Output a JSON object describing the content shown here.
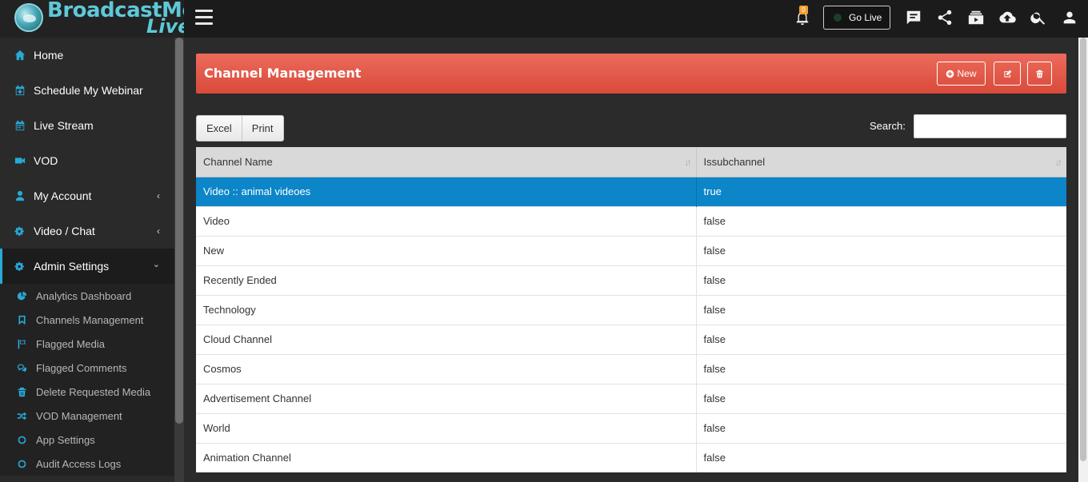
{
  "app": {
    "logo_text": "BroadcastMe",
    "logo_text2": "Live"
  },
  "topbar": {
    "notification_count": "0",
    "go_live_label": "Go Live"
  },
  "sidebar": {
    "items": [
      {
        "label": "Home",
        "icon": "home-icon"
      },
      {
        "label": "Schedule My Webinar",
        "icon": "calendar-plus-icon"
      },
      {
        "label": "Live Stream",
        "icon": "calendar-icon"
      },
      {
        "label": "VOD",
        "icon": "video-camera-icon"
      },
      {
        "label": "My Account",
        "icon": "user-icon"
      },
      {
        "label": "Video / Chat",
        "icon": "gears-icon"
      },
      {
        "label": "Admin Settings",
        "icon": "gears-icon"
      }
    ],
    "sub_items": [
      {
        "label": "Analytics Dashboard",
        "icon": "pie-chart-icon"
      },
      {
        "label": "Channels Management",
        "icon": "bookmark-icon"
      },
      {
        "label": "Flagged Media",
        "icon": "flag-icon"
      },
      {
        "label": "Flagged Comments",
        "icon": "comments-icon"
      },
      {
        "label": "Delete Requested Media",
        "icon": "trash-icon"
      },
      {
        "label": "VOD Management",
        "icon": "shuffle-icon"
      },
      {
        "label": "App Settings",
        "icon": "circle-icon"
      },
      {
        "label": "Audit Access Logs",
        "icon": "circle-icon"
      }
    ]
  },
  "panel": {
    "title": "Channel Management",
    "new_label": "New"
  },
  "toolbar": {
    "excel_label": "Excel",
    "print_label": "Print",
    "search_label": "Search:",
    "search_value": ""
  },
  "table": {
    "columns": [
      "Channel Name",
      "Issubchannel"
    ],
    "rows": [
      [
        "Video :: animal videoes",
        "true"
      ],
      [
        "Video",
        "false"
      ],
      [
        "New",
        "false"
      ],
      [
        "Recently Ended",
        "false"
      ],
      [
        "Technology",
        "false"
      ],
      [
        "Cloud Channel",
        "false"
      ],
      [
        "Cosmos",
        "false"
      ],
      [
        "Advertisement Channel",
        "false"
      ],
      [
        "World",
        "false"
      ],
      [
        "Animation Channel",
        "false"
      ]
    ]
  },
  "colors": {
    "accent": "#28a9d6",
    "header_red": "#e05a48",
    "selected_row": "#0c86c8"
  }
}
